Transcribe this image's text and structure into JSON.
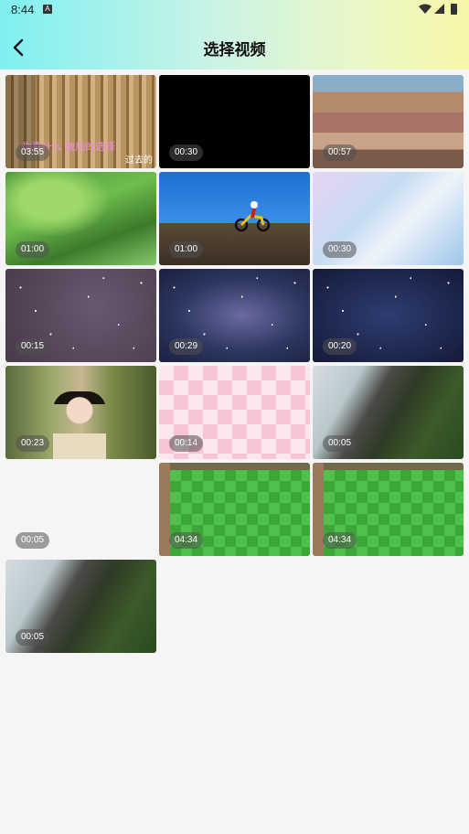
{
  "status_bar": {
    "time": "8:44",
    "notif_icon": "a-letter-icon"
  },
  "header": {
    "title": "选择视频"
  },
  "videos": [
    {
      "duration": "03:55",
      "lyric_left": "你喜什么 做后的选择",
      "lyric_right": "过去的"
    },
    {
      "duration": "00:30"
    },
    {
      "duration": "00:57"
    },
    {
      "duration": "01:00"
    },
    {
      "duration": "01:00"
    },
    {
      "duration": "00:30"
    },
    {
      "duration": "00:15"
    },
    {
      "duration": "00:29"
    },
    {
      "duration": "00:20"
    },
    {
      "duration": "00:23"
    },
    {
      "duration": "00:14"
    },
    {
      "duration": "00:05"
    },
    {
      "duration": "00:05"
    },
    {
      "duration": "04:34"
    },
    {
      "duration": "04:34"
    },
    {
      "duration": "00:05"
    }
  ]
}
